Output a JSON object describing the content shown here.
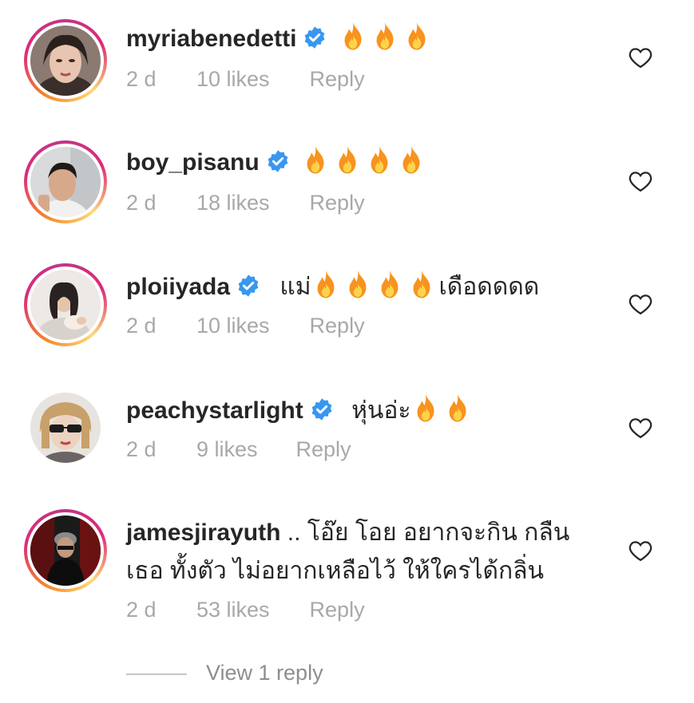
{
  "comments": [
    {
      "username": "myriabenedetti",
      "verified": true,
      "text": "",
      "fire_count": 3,
      "text_after": "",
      "time": "2 d",
      "likes": "10 likes",
      "reply": "Reply"
    },
    {
      "username": "boy_pisanu",
      "verified": true,
      "text": "",
      "fire_count": 4,
      "text_after": "",
      "time": "2 d",
      "likes": "18 likes",
      "reply": "Reply"
    },
    {
      "username": "ploiiyada",
      "verified": true,
      "text": "แม่",
      "fire_count": 4,
      "text_after": "เดือดดดด",
      "time": "2 d",
      "likes": "10 likes",
      "reply": "Reply"
    },
    {
      "username": "peachystarlight",
      "verified": true,
      "text": "หุ่นอ่ะ",
      "fire_count": 2,
      "text_after": "",
      "time": "2 d",
      "likes": "9 likes",
      "reply": "Reply"
    },
    {
      "username": "jamesjirayuth",
      "verified": false,
      "text": ".. โอ๊ย โอย อยากจะกิน กลืน",
      "text_line2": "เธอ ทั้งตัว ไม่อยากเหลือไว้ ให้ใครได้กลิ่น",
      "time": "2 d",
      "likes": "53 likes",
      "reply": "Reply"
    }
  ],
  "view_replies": "View 1 reply",
  "colors": {
    "verified": "#3897f0",
    "meta": "#a8a8a8",
    "fire": "#f7931e"
  },
  "icons": {
    "like": "heart-outline-icon",
    "verified": "verified-badge-icon",
    "emoji": "fire-emoji"
  }
}
